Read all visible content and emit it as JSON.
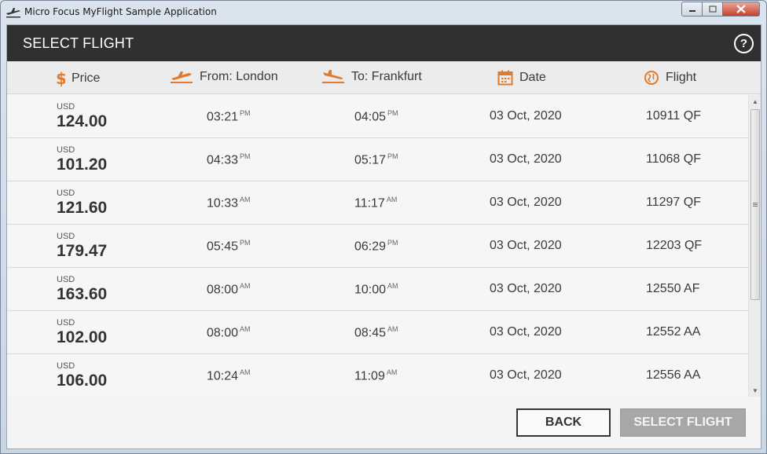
{
  "window": {
    "title": "Micro Focus MyFlight Sample Application"
  },
  "header": {
    "title": "SELECT FLIGHT",
    "help_label": "?"
  },
  "columns": {
    "price": "Price",
    "from": "From: London",
    "to": "To: Frankfurt",
    "date": "Date",
    "flight": "Flight"
  },
  "colors": {
    "accent": "#e07a2f",
    "header_bg": "#303030"
  },
  "icons": {
    "price": "dollar-icon",
    "from": "takeoff-icon",
    "to": "landing-icon",
    "date": "calendar-icon",
    "flight": "globe-icon"
  },
  "flights": [
    {
      "currency": "USD",
      "price": "124.00",
      "dep_time": "03:21",
      "dep_ampm": "PM",
      "arr_time": "04:05",
      "arr_ampm": "PM",
      "date": "03 Oct, 2020",
      "flight": "10911 QF"
    },
    {
      "currency": "USD",
      "price": "101.20",
      "dep_time": "04:33",
      "dep_ampm": "PM",
      "arr_time": "05:17",
      "arr_ampm": "PM",
      "date": "03 Oct, 2020",
      "flight": "11068 QF"
    },
    {
      "currency": "USD",
      "price": "121.60",
      "dep_time": "10:33",
      "dep_ampm": "AM",
      "arr_time": "11:17",
      "arr_ampm": "AM",
      "date": "03 Oct, 2020",
      "flight": "11297 QF"
    },
    {
      "currency": "USD",
      "price": "179.47",
      "dep_time": "05:45",
      "dep_ampm": "PM",
      "arr_time": "06:29",
      "arr_ampm": "PM",
      "date": "03 Oct, 2020",
      "flight": "12203 QF"
    },
    {
      "currency": "USD",
      "price": "163.60",
      "dep_time": "08:00",
      "dep_ampm": "AM",
      "arr_time": "10:00",
      "arr_ampm": "AM",
      "date": "03 Oct, 2020",
      "flight": "12550 AF"
    },
    {
      "currency": "USD",
      "price": "102.00",
      "dep_time": "08:00",
      "dep_ampm": "AM",
      "arr_time": "08:45",
      "arr_ampm": "AM",
      "date": "03 Oct, 2020",
      "flight": "12552 AA"
    },
    {
      "currency": "USD",
      "price": "106.00",
      "dep_time": "10:24",
      "dep_ampm": "AM",
      "arr_time": "11:09",
      "arr_ampm": "AM",
      "date": "03 Oct, 2020",
      "flight": "12556 AA"
    }
  ],
  "footer": {
    "back_label": "BACK",
    "select_label": "SELECT FLIGHT"
  }
}
